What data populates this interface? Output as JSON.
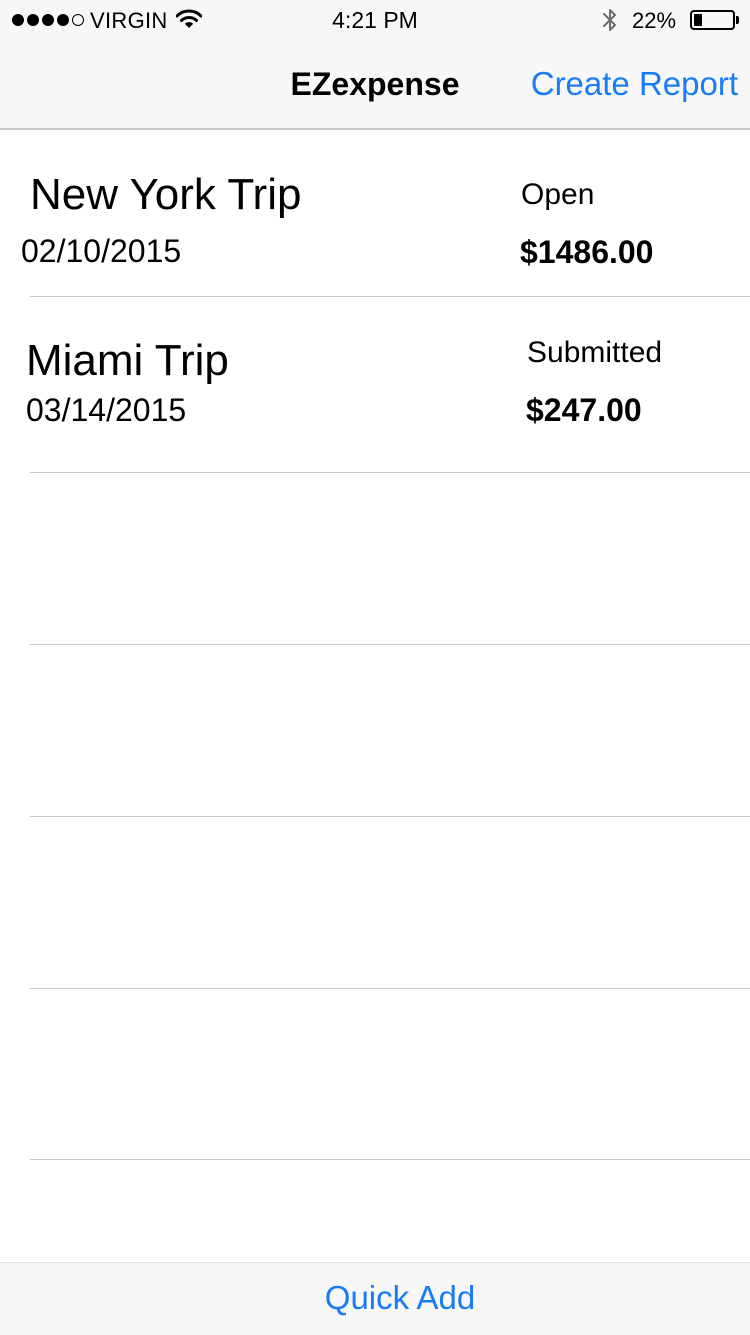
{
  "status_bar": {
    "signal_bars_filled": 4,
    "signal_bars_total": 5,
    "carrier": "VIRGIN",
    "time": "4:21 PM",
    "battery_percent": "22%",
    "battery_level": 0.22
  },
  "nav": {
    "title": "EZexpense",
    "create_report_label": "Create Report"
  },
  "reports": [
    {
      "name": "New York Trip",
      "date": "02/10/2015",
      "status": "Open",
      "amount": "$1486.00"
    },
    {
      "name": "Miami Trip",
      "date": "03/14/2015",
      "status": "Submitted",
      "amount": "$247.00"
    }
  ],
  "toolbar": {
    "quick_add_label": "Quick Add"
  },
  "colors": {
    "accent": "#1a7cf5",
    "bar_background": "#f7f7f7",
    "separator": "#c8c7cc"
  },
  "icons": {
    "wifi": "wifi-icon",
    "bluetooth": "bluetooth-icon",
    "battery": "battery-icon"
  }
}
